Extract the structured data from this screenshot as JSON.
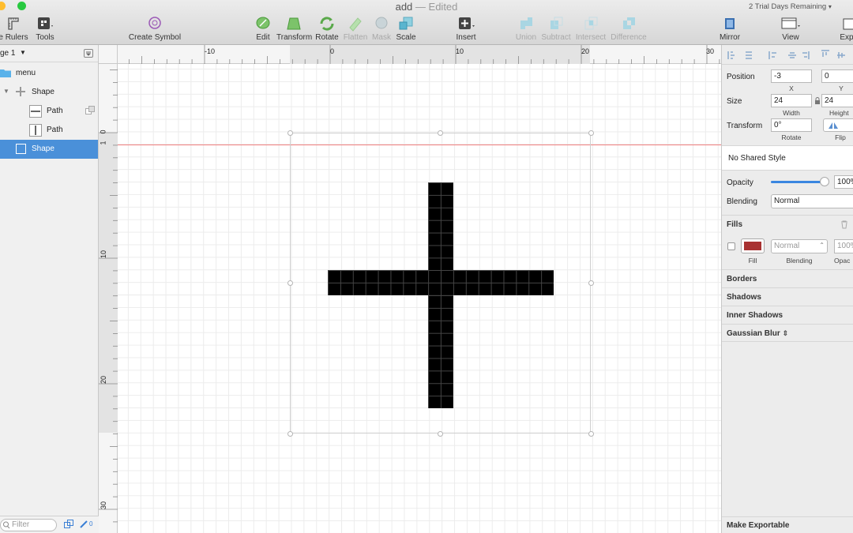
{
  "window": {
    "title": "add",
    "edited": "— Edited",
    "trial": "2 Trial Days Remaining"
  },
  "toolbar": {
    "rulers": "e Rulers",
    "tools": "Tools",
    "create_symbol": "Create Symbol",
    "edit": "Edit",
    "transform": "Transform",
    "rotate": "Rotate",
    "flatten": "Flatten",
    "mask": "Mask",
    "scale": "Scale",
    "insert": "Insert",
    "union": "Union",
    "subtract": "Subtract",
    "intersect": "Intersect",
    "difference": "Difference",
    "mirror": "Mirror",
    "view": "View",
    "export": "Exp"
  },
  "layers": {
    "page": "ge 1",
    "items": [
      {
        "label": "menu"
      },
      {
        "label": "Shape"
      },
      {
        "label": "Path"
      },
      {
        "label": "Path"
      },
      {
        "label": "Shape"
      }
    ],
    "filter_placeholder": "Filter",
    "count": "0"
  },
  "rulers": {
    "h_labels": [
      "-10",
      "0",
      "10",
      "20",
      "30"
    ],
    "v_labels": [
      "0",
      "1",
      "10",
      "20",
      "30"
    ]
  },
  "inspector": {
    "position_label": "Position",
    "x_value": "-3",
    "y_value": "0",
    "x_sub": "X",
    "y_sub": "Y",
    "size_label": "Size",
    "width_value": "24",
    "height_value": "24",
    "width_sub": "Width",
    "height_sub": "Height",
    "transform_label": "Transform",
    "rotate_value": "0°",
    "rotate_sub": "Rotate",
    "flip_sub": "Flip",
    "shared_style": "No Shared Style",
    "opacity_label": "Opacity",
    "opacity_value": "100%",
    "opacity_level": 1.0,
    "blending_label": "Blending",
    "blending_value": "Normal",
    "fills_title": "Fills",
    "fill_color": "#a83232",
    "fill_blend": "Normal",
    "fill_opacity": "100%",
    "fill_sub": "Fill",
    "fill_blend_sub": "Blending",
    "fill_opacity_sub": "Opac",
    "borders": "Borders",
    "shadows": "Shadows",
    "inner_shadows": "Inner Shadows",
    "gaussian_blur": "Gaussian Blur",
    "make_exportable": "Make Exportable"
  },
  "colors": {
    "accent": "#4a90d9",
    "guide": "#f08080",
    "shape": "#000000"
  }
}
